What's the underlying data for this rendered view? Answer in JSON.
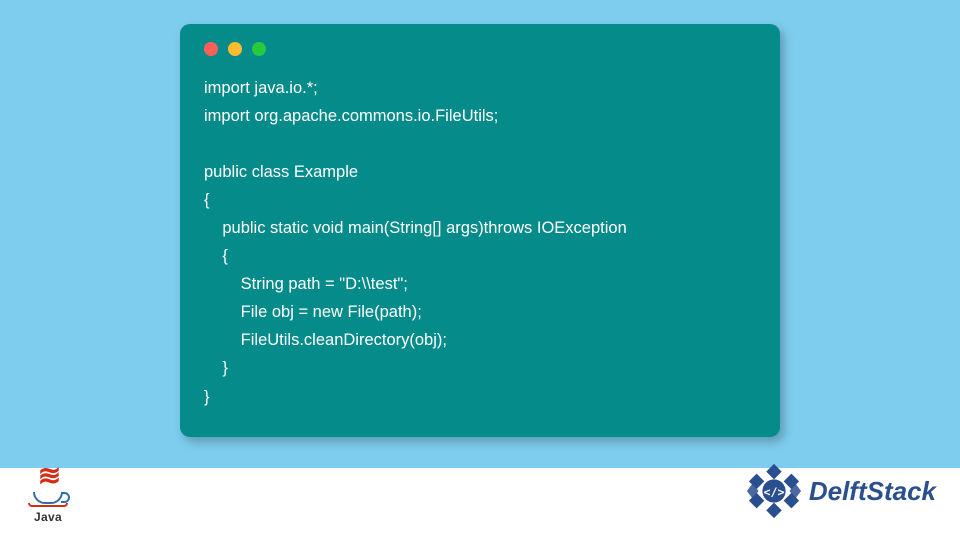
{
  "window": {
    "controls": [
      "red",
      "yellow",
      "green"
    ]
  },
  "code": {
    "line1": "import java.io.*;",
    "line2": "import org.apache.commons.io.FileUtils;",
    "line3": "",
    "line4": "public class Example",
    "line5": "{",
    "line6": "    public static void main(String[] args)throws IOException",
    "line7": "    {",
    "line8": "        String path = \"D:\\\\test\";",
    "line9": "        File obj = new File(path);",
    "line10": "        FileUtils.cleanDirectory(obj);",
    "line11": "    }",
    "line12": "}"
  },
  "java_logo": {
    "text": "Java"
  },
  "delft": {
    "text": "DelftStack"
  },
  "colors": {
    "bg": "#7ecdee",
    "window": "#068b8b",
    "code_text": "#ffffff",
    "delft_blue": "#2a4f8f"
  }
}
